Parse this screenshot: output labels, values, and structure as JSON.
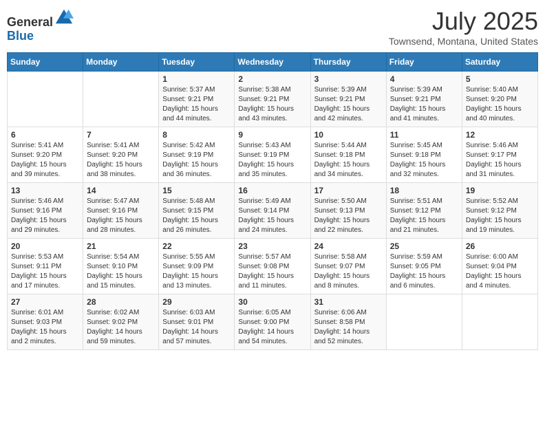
{
  "logo": {
    "general": "General",
    "blue": "Blue"
  },
  "header": {
    "month": "July 2025",
    "location": "Townsend, Montana, United States"
  },
  "weekdays": [
    "Sunday",
    "Monday",
    "Tuesday",
    "Wednesday",
    "Thursday",
    "Friday",
    "Saturday"
  ],
  "weeks": [
    [
      {
        "day": "",
        "info": ""
      },
      {
        "day": "",
        "info": ""
      },
      {
        "day": "1",
        "info": "Sunrise: 5:37 AM\nSunset: 9:21 PM\nDaylight: 15 hours and 44 minutes."
      },
      {
        "day": "2",
        "info": "Sunrise: 5:38 AM\nSunset: 9:21 PM\nDaylight: 15 hours and 43 minutes."
      },
      {
        "day": "3",
        "info": "Sunrise: 5:39 AM\nSunset: 9:21 PM\nDaylight: 15 hours and 42 minutes."
      },
      {
        "day": "4",
        "info": "Sunrise: 5:39 AM\nSunset: 9:21 PM\nDaylight: 15 hours and 41 minutes."
      },
      {
        "day": "5",
        "info": "Sunrise: 5:40 AM\nSunset: 9:20 PM\nDaylight: 15 hours and 40 minutes."
      }
    ],
    [
      {
        "day": "6",
        "info": "Sunrise: 5:41 AM\nSunset: 9:20 PM\nDaylight: 15 hours and 39 minutes."
      },
      {
        "day": "7",
        "info": "Sunrise: 5:41 AM\nSunset: 9:20 PM\nDaylight: 15 hours and 38 minutes."
      },
      {
        "day": "8",
        "info": "Sunrise: 5:42 AM\nSunset: 9:19 PM\nDaylight: 15 hours and 36 minutes."
      },
      {
        "day": "9",
        "info": "Sunrise: 5:43 AM\nSunset: 9:19 PM\nDaylight: 15 hours and 35 minutes."
      },
      {
        "day": "10",
        "info": "Sunrise: 5:44 AM\nSunset: 9:18 PM\nDaylight: 15 hours and 34 minutes."
      },
      {
        "day": "11",
        "info": "Sunrise: 5:45 AM\nSunset: 9:18 PM\nDaylight: 15 hours and 32 minutes."
      },
      {
        "day": "12",
        "info": "Sunrise: 5:46 AM\nSunset: 9:17 PM\nDaylight: 15 hours and 31 minutes."
      }
    ],
    [
      {
        "day": "13",
        "info": "Sunrise: 5:46 AM\nSunset: 9:16 PM\nDaylight: 15 hours and 29 minutes."
      },
      {
        "day": "14",
        "info": "Sunrise: 5:47 AM\nSunset: 9:16 PM\nDaylight: 15 hours and 28 minutes."
      },
      {
        "day": "15",
        "info": "Sunrise: 5:48 AM\nSunset: 9:15 PM\nDaylight: 15 hours and 26 minutes."
      },
      {
        "day": "16",
        "info": "Sunrise: 5:49 AM\nSunset: 9:14 PM\nDaylight: 15 hours and 24 minutes."
      },
      {
        "day": "17",
        "info": "Sunrise: 5:50 AM\nSunset: 9:13 PM\nDaylight: 15 hours and 22 minutes."
      },
      {
        "day": "18",
        "info": "Sunrise: 5:51 AM\nSunset: 9:12 PM\nDaylight: 15 hours and 21 minutes."
      },
      {
        "day": "19",
        "info": "Sunrise: 5:52 AM\nSunset: 9:12 PM\nDaylight: 15 hours and 19 minutes."
      }
    ],
    [
      {
        "day": "20",
        "info": "Sunrise: 5:53 AM\nSunset: 9:11 PM\nDaylight: 15 hours and 17 minutes."
      },
      {
        "day": "21",
        "info": "Sunrise: 5:54 AM\nSunset: 9:10 PM\nDaylight: 15 hours and 15 minutes."
      },
      {
        "day": "22",
        "info": "Sunrise: 5:55 AM\nSunset: 9:09 PM\nDaylight: 15 hours and 13 minutes."
      },
      {
        "day": "23",
        "info": "Sunrise: 5:57 AM\nSunset: 9:08 PM\nDaylight: 15 hours and 11 minutes."
      },
      {
        "day": "24",
        "info": "Sunrise: 5:58 AM\nSunset: 9:07 PM\nDaylight: 15 hours and 8 minutes."
      },
      {
        "day": "25",
        "info": "Sunrise: 5:59 AM\nSunset: 9:05 PM\nDaylight: 15 hours and 6 minutes."
      },
      {
        "day": "26",
        "info": "Sunrise: 6:00 AM\nSunset: 9:04 PM\nDaylight: 15 hours and 4 minutes."
      }
    ],
    [
      {
        "day": "27",
        "info": "Sunrise: 6:01 AM\nSunset: 9:03 PM\nDaylight: 15 hours and 2 minutes."
      },
      {
        "day": "28",
        "info": "Sunrise: 6:02 AM\nSunset: 9:02 PM\nDaylight: 14 hours and 59 minutes."
      },
      {
        "day": "29",
        "info": "Sunrise: 6:03 AM\nSunset: 9:01 PM\nDaylight: 14 hours and 57 minutes."
      },
      {
        "day": "30",
        "info": "Sunrise: 6:05 AM\nSunset: 9:00 PM\nDaylight: 14 hours and 54 minutes."
      },
      {
        "day": "31",
        "info": "Sunrise: 6:06 AM\nSunset: 8:58 PM\nDaylight: 14 hours and 52 minutes."
      },
      {
        "day": "",
        "info": ""
      },
      {
        "day": "",
        "info": ""
      }
    ]
  ]
}
